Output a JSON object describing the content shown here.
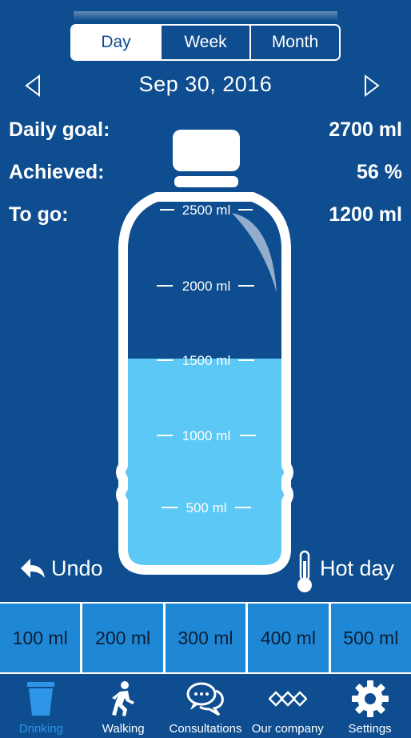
{
  "period_selector": {
    "options": [
      "Day",
      "Week",
      "Month"
    ],
    "selected": "Day"
  },
  "date": {
    "label": "Sep 30, 2016",
    "prev_icon": "chevron-left-icon",
    "next_icon": "chevron-right-icon"
  },
  "stats": {
    "daily_goal_label": "Daily goal:",
    "daily_goal_value": "2700 ml",
    "achieved_label": "Achieved:",
    "achieved_value": "56 %",
    "to_go_label": "To go:",
    "to_go_value": "1200 ml"
  },
  "bottle": {
    "scale_marks": [
      "2500 ml",
      "2000 ml",
      "1500 ml",
      "1000 ml",
      "500 ml"
    ],
    "fill_ml": 1500,
    "max_ml": 2500,
    "water_color": "#5cc8f6",
    "outline_color": "#ffffff"
  },
  "actions": {
    "undo_label": "Undo",
    "hot_day_label": "Hot day"
  },
  "amounts": [
    "100 ml",
    "200 ml",
    "300 ml",
    "400 ml",
    "500 ml"
  ],
  "tabs": [
    {
      "label": "Drinking",
      "icon": "cup-icon",
      "active": true
    },
    {
      "label": "Walking",
      "icon": "walking-person-icon",
      "active": false
    },
    {
      "label": "Consultations",
      "icon": "chat-bubbles-icon",
      "active": false
    },
    {
      "label": "Our company",
      "icon": "company-logo-icon",
      "active": false
    },
    {
      "label": "Settings",
      "icon": "gear-icon",
      "active": false
    }
  ],
  "colors": {
    "background": "#0e4d8f",
    "amount_button": "#1f88d6",
    "active_tab": "#2e96e6"
  }
}
